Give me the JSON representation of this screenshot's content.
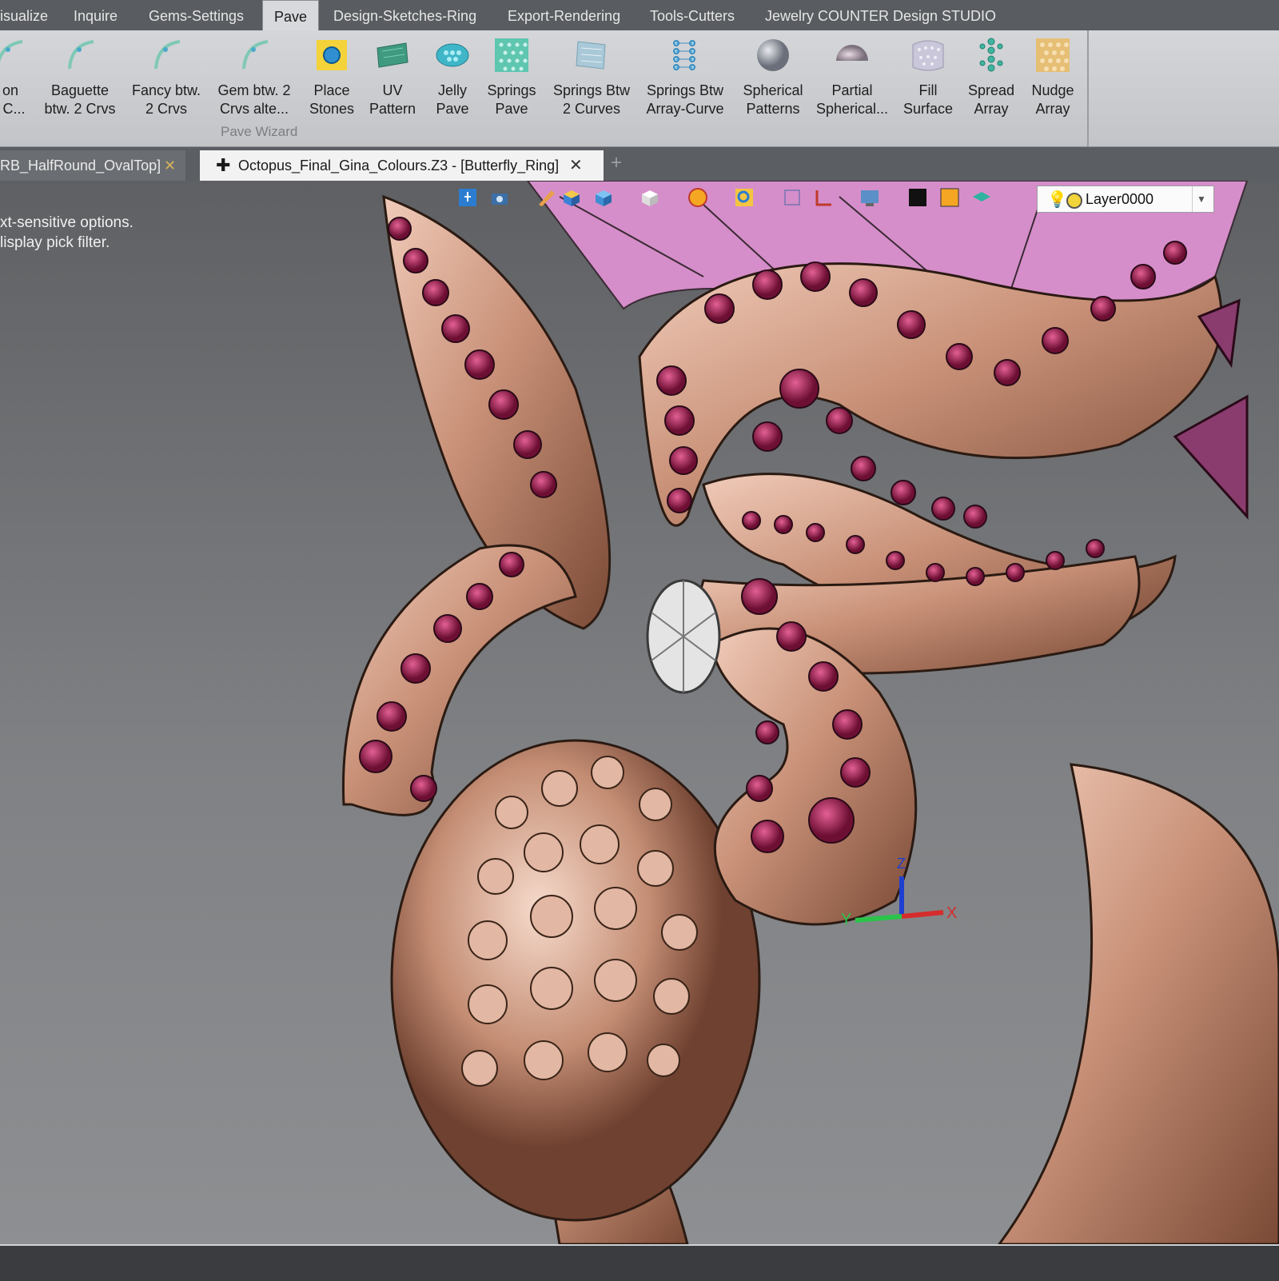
{
  "menu": {
    "tabs": [
      {
        "label": "isualize"
      },
      {
        "label": "Inquire"
      },
      {
        "label": "Gems-Settings"
      },
      {
        "label": "Pave"
      },
      {
        "label": "Design-Sketches-Ring"
      },
      {
        "label": "Export-Rendering"
      },
      {
        "label": "Tools-Cutters"
      },
      {
        "label": "Jewelry COUNTER Design STUDIO"
      }
    ]
  },
  "ribbon": {
    "buttons": [
      {
        "line1": "on",
        "line2": "l C...",
        "icon": "curve-gem-icon"
      },
      {
        "line1": "Baguette",
        "line2": "btw. 2 Crvs",
        "icon": "curve-gem-icon"
      },
      {
        "line1": "Fancy btw.",
        "line2": "2 Crvs",
        "icon": "curve-gem-icon"
      },
      {
        "line1": "Gem btw. 2",
        "line2": "Crvs alte...",
        "icon": "curve-gem-icon"
      },
      {
        "line1": "Place",
        "line2": "Stones",
        "icon": "place-stones-icon"
      },
      {
        "line1": "UV",
        "line2": "Pattern",
        "icon": "uv-pattern-icon"
      },
      {
        "line1": "Jelly",
        "line2": "Pave",
        "icon": "jelly-pave-icon"
      },
      {
        "line1": "Springs",
        "line2": "Pave",
        "icon": "springs-pave-icon"
      },
      {
        "line1": "Springs Btw",
        "line2": "2 Curves",
        "icon": "springs-curves-icon"
      },
      {
        "line1": "Springs Btw",
        "line2": "Array-Curve",
        "icon": "springs-array-icon"
      },
      {
        "line1": "Spherical",
        "line2": "Patterns",
        "icon": "sphere-icon"
      },
      {
        "line1": "Partial",
        "line2": "Spherical...",
        "icon": "half-sphere-icon"
      },
      {
        "line1": "Fill",
        "line2": "Surface",
        "icon": "fill-surface-icon"
      },
      {
        "line1": "Spread",
        "line2": "Array",
        "icon": "spread-array-icon"
      },
      {
        "line1": "Nudge",
        "line2": "Array",
        "icon": "nudge-array-icon"
      }
    ],
    "group_label": "Pave Wizard"
  },
  "doc_tabs": [
    {
      "label": "RB_HalfRound_OvalTop]",
      "active": false
    },
    {
      "label": "Octopus_Final_Gina_Colours.Z3 - [Butterfly_Ring]",
      "active": true
    }
  ],
  "viewport": {
    "hint_line1": "xt-sensitive options.",
    "hint_line2": "lisplay pick filter.",
    "layer": "Layer0000",
    "axis": {
      "x": "X",
      "y": "Y",
      "z": "Z"
    },
    "colors": {
      "metal": "#c99178",
      "gem": "#8e1742",
      "background": "#7b7d80",
      "band": "#e2a5e0"
    }
  }
}
